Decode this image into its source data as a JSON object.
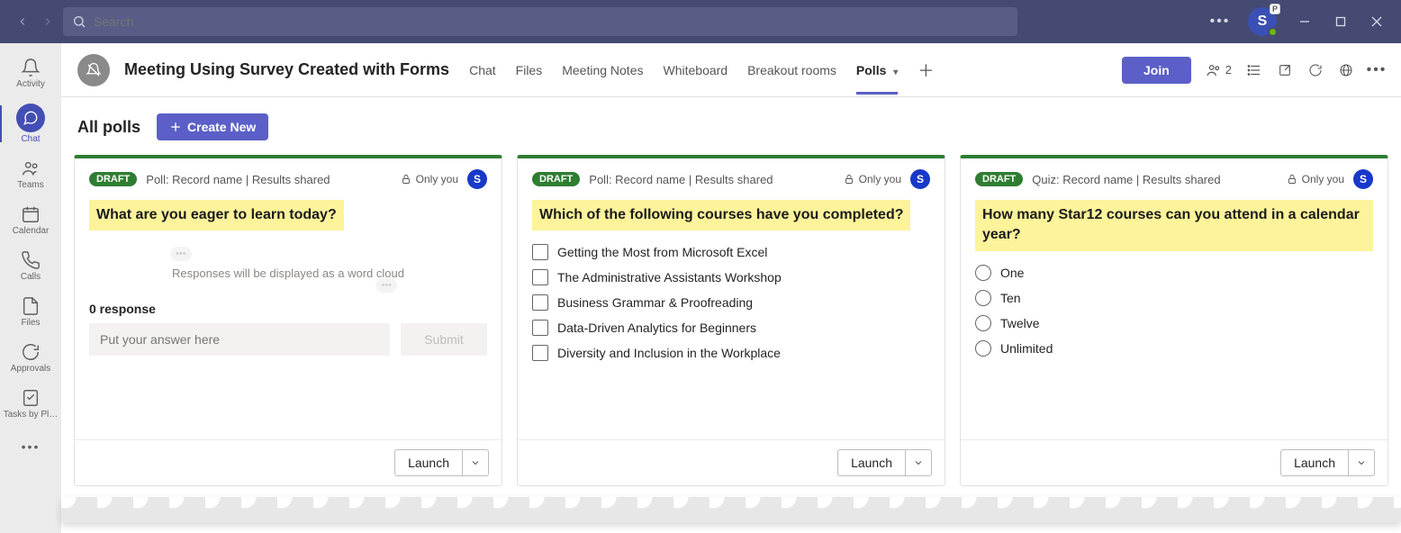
{
  "search": {
    "placeholder": "Search"
  },
  "titlebar": {
    "avatar_letter": "S",
    "avatar_presence_label": "P"
  },
  "rail": {
    "items": [
      {
        "id": "activity",
        "label": "Activity"
      },
      {
        "id": "chat",
        "label": "Chat"
      },
      {
        "id": "teams",
        "label": "Teams"
      },
      {
        "id": "calendar",
        "label": "Calendar"
      },
      {
        "id": "calls",
        "label": "Calls"
      },
      {
        "id": "files",
        "label": "Files"
      },
      {
        "id": "approvals",
        "label": "Approvals"
      },
      {
        "id": "tasks",
        "label": "Tasks by Pl…"
      }
    ]
  },
  "meeting": {
    "title": "Meeting Using Survey Created with Forms",
    "tabs": [
      "Chat",
      "Files",
      "Meeting Notes",
      "Whiteboard",
      "Breakout rooms",
      "Polls"
    ],
    "active_tab": "Polls",
    "join_label": "Join",
    "people_count": "2"
  },
  "polls_page": {
    "heading": "All polls",
    "create_label": "Create New"
  },
  "cards": [
    {
      "badge": "DRAFT",
      "meta": "Poll: Record name | Results shared",
      "only_you": "Only you",
      "avatar_letter": "S",
      "question": "What are you eager to learn today?",
      "type": "wordcloud",
      "placeholder_text": "Responses will be displayed as a word cloud",
      "response_count": "0 response",
      "answer_placeholder": "Put your answer here",
      "submit_label": "Submit",
      "launch_label": "Launch"
    },
    {
      "badge": "DRAFT",
      "meta": "Poll: Record name | Results shared",
      "only_you": "Only you",
      "avatar_letter": "S",
      "question": "Which of the following courses have you completed?",
      "type": "checkbox",
      "options": [
        "Getting the Most from Microsoft Excel",
        "The Administrative Assistants Workshop",
        "Business Grammar & Proofreading",
        "Data-Driven Analytics for Beginners",
        "Diversity and Inclusion in the Workplace"
      ],
      "launch_label": "Launch"
    },
    {
      "badge": "DRAFT",
      "meta": "Quiz: Record name | Results shared",
      "only_you": "Only you",
      "avatar_letter": "S",
      "question": "How many Star12 courses can you attend in a calendar year?",
      "type": "radio",
      "options": [
        "One",
        "Ten",
        "Twelve",
        "Unlimited"
      ],
      "launch_label": "Launch"
    }
  ]
}
